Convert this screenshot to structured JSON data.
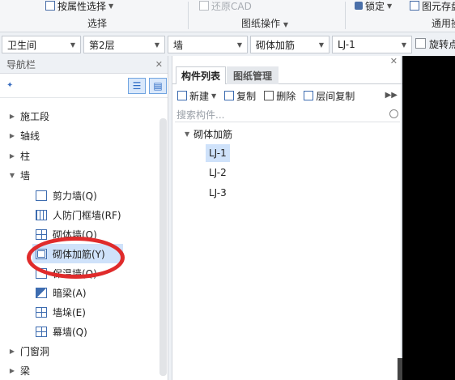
{
  "ribbon": {
    "attr_select": "按属性选择",
    "group_select": "选择",
    "restore_cad": "还原CAD",
    "group_drawing_ops": "图纸操作",
    "lock": "锁定",
    "element_save": "图元存盘",
    "group_general": "通用操"
  },
  "selectors": {
    "room": "卫生间",
    "floor": "第2层",
    "category": "墙",
    "type": "砌体加筋",
    "instance": "LJ-1",
    "rotate_label": "旋转点"
  },
  "nav": {
    "title": "导航栏",
    "tree": [
      {
        "label": "施工段",
        "expanded": false
      },
      {
        "label": "轴线",
        "expanded": false
      },
      {
        "label": "柱",
        "expanded": false
      },
      {
        "label": "墙",
        "expanded": true,
        "children": [
          {
            "label": "剪力墙(Q)",
            "icon": "shear-wall-icon"
          },
          {
            "label": "人防门框墙(RF)",
            "icon": "civil-defense-door-wall-icon"
          },
          {
            "label": "砌体墙(Q)",
            "icon": "masonry-wall-icon"
          },
          {
            "label": "砌体加筋(Y)",
            "icon": "masonry-reinforcement-icon",
            "selected": true
          },
          {
            "label": "保温墙(Q)",
            "icon": "insulation-wall-icon"
          },
          {
            "label": "暗梁(A)",
            "icon": "hidden-beam-icon"
          },
          {
            "label": "墙垛(E)",
            "icon": "wall-pier-icon"
          },
          {
            "label": "幕墙(Q)",
            "icon": "curtain-wall-icon"
          }
        ]
      },
      {
        "label": "门窗洞",
        "expanded": false
      },
      {
        "label": "梁",
        "expanded": false
      }
    ]
  },
  "component_panel": {
    "tab_list": "构件列表",
    "tab_drawing": "图纸管理",
    "new": "新建",
    "copy": "复制",
    "delete": "删除",
    "floor_copy": "层间复制",
    "search_placeholder": "搜索构件...",
    "group": "砌体加筋",
    "items": [
      {
        "label": "LJ-1",
        "selected": true
      },
      {
        "label": "LJ-2",
        "selected": false
      },
      {
        "label": "LJ-3",
        "selected": false
      }
    ]
  }
}
